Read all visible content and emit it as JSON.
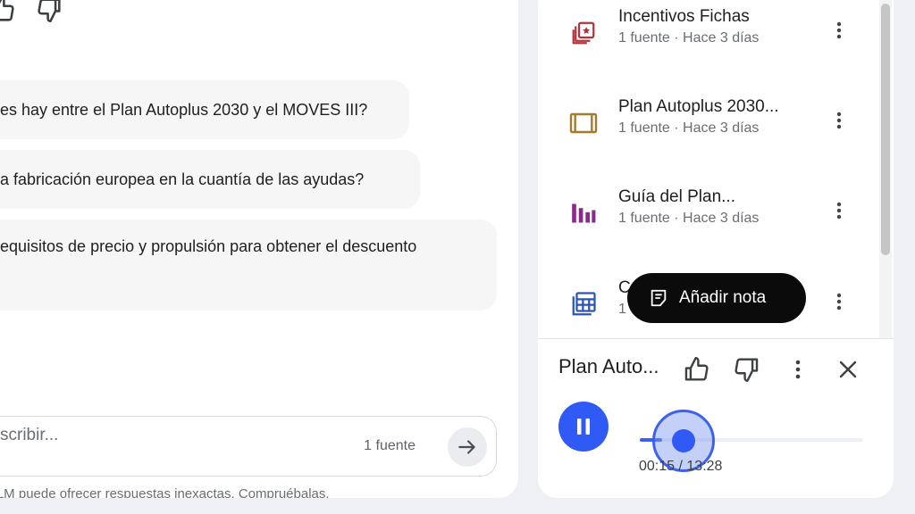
{
  "chat": {
    "messages": [
      {
        "text": "es hay entre el Plan Autoplus 2030 y el MOVES III?"
      },
      {
        "text": "a fabricación europea en la cuantía de las ayudas?"
      },
      {
        "text": "equisitos de precio y propulsión para obtener el descuento"
      }
    ],
    "composer": {
      "placeholder": "scribir...",
      "source_count": "1 fuente"
    },
    "disclaimer": "okLM puede ofrecer respuestas inexactas. Compruébalas."
  },
  "sources": {
    "items": [
      {
        "title": "Incentivos Fichas",
        "meta": "1 fuente · Hace 3 días",
        "icon": "slides-icon",
        "color": "#b3323b"
      },
      {
        "title": "Plan Autoplus 2030...",
        "meta": "1 fuente · Hace 3 días",
        "icon": "video-frame-icon",
        "color": "#a27b2e"
      },
      {
        "title": "Guía del Plan...",
        "meta": "1 fuente · Hace 3 días",
        "icon": "chart-bars-icon",
        "color": "#8b2a8c"
      },
      {
        "title": "C",
        "meta": "1",
        "icon": "table-icon",
        "color": "#2c53b6"
      }
    ]
  },
  "tooltip": {
    "label": "Añadir nota"
  },
  "player": {
    "title": "Plan Auto...",
    "elapsed": "00:15",
    "separator": " / ",
    "duration": "13:28",
    "progress": 0.1
  },
  "colors": {
    "accent": "#2f5af6"
  }
}
